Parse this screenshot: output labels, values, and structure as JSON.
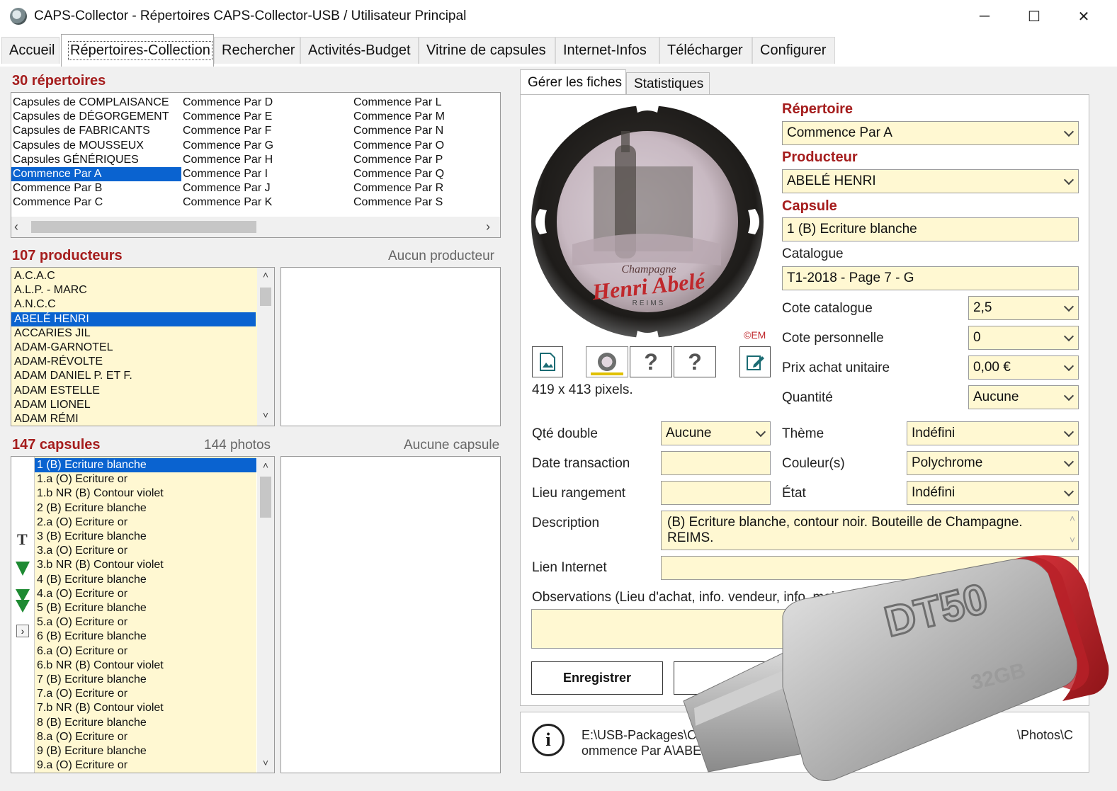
{
  "window": {
    "title": "CAPS-Collector - Répertoires CAPS-Collector-USB / Utilisateur Principal",
    "minimize": "─",
    "maximize": "☐",
    "close": "✕"
  },
  "tabs": [
    "Accueil",
    "Répertoires-Collection",
    "Rechercher",
    "Activités-Budget",
    "Vitrine de capsules",
    "Internet-Infos",
    "Télécharger",
    "Configurer"
  ],
  "repertoires": {
    "title": "30 répertoires",
    "col1": [
      "Capsules de COMPLAISANCE",
      "Capsules de DÉGORGEMENT",
      "Capsules de FABRICANTS",
      "Capsules de MOUSSEUX",
      "Capsules GÉNÉRIQUES",
      "Commence Par A",
      "Commence Par B",
      "Commence Par C"
    ],
    "col2": [
      "Commence Par D",
      "Commence Par E",
      "Commence Par F",
      "Commence Par G",
      "Commence Par H",
      "Commence Par I",
      "Commence Par J",
      "Commence Par K"
    ],
    "col3": [
      "Commence Par L",
      "Commence Par M",
      "Commence Par N",
      "Commence Par O",
      "Commence Par P",
      "Commence Par Q",
      "Commence Par R",
      "Commence Par S"
    ],
    "selected": "Commence Par A"
  },
  "producteurs": {
    "title": "107 producteurs",
    "right_label": "Aucun producteur",
    "items": [
      "A.C.A.C",
      "A.L.P. - MARC",
      "A.N.C.C",
      "ABELÉ HENRI",
      "ACCARIES JIL",
      "ADAM-GARNOTEL",
      "ADAM-RÉVOLTE",
      "ADAM DANIEL P. ET F.",
      "ADAM ESTELLE",
      "ADAM LIONEL",
      "ADAM RÉMI"
    ],
    "selected": "ABELÉ HENRI"
  },
  "capsules": {
    "title": "147 capsules",
    "photos": "144 photos",
    "right_label": "Aucune capsule",
    "items": [
      "1 (B) Ecriture blanche",
      "1.a (O) Ecriture or",
      "1.b NR (B) Contour violet",
      "2 (B) Ecriture blanche",
      "2.a (O) Ecriture or",
      "3 (B) Ecriture blanche",
      "3.a (O) Ecriture or",
      "3.b NR (B) Contour violet",
      "4 (B) Ecriture blanche",
      "4.a (O) Ecriture or",
      "5 (B) Ecriture blanche",
      "5.a (O) Ecriture or",
      "6 (B) Ecriture blanche",
      "6.a (O) Ecriture or",
      "6.b NR (B) Contour violet",
      "7 (B) Ecriture blanche",
      "7.a (O) Ecriture or",
      "7.b NR (B) Contour violet",
      "8 (B) Ecriture blanche",
      "8.a (O) Ecriture or",
      "9 (B) Ecriture blanche",
      "9.a (O) Ecriture or"
    ],
    "selected": "1 (B) Ecriture blanche",
    "side_tools": {
      "t": "T",
      "next": "▼",
      "last": "▼",
      "expand": "›"
    }
  },
  "right_tabs": [
    "Gérer les fiches",
    "Statistiques"
  ],
  "capsule_image": {
    "text_champagne": "Champagne",
    "text_brand": "Henri Abelé",
    "text_city": "REIMS",
    "copyright": "©EM",
    "size_text": "419 x 413 pixels.",
    "buttons": [
      "image-icon",
      "capsule-thumb-icon",
      "question-icon",
      "question-icon",
      "edit-icon"
    ],
    "question_mark": "?"
  },
  "form": {
    "repertoire_label": "Répertoire",
    "repertoire_value": "Commence Par A",
    "producteur_label": "Producteur",
    "producteur_value": "ABELÉ HENRI",
    "capsule_label": "Capsule",
    "capsule_value": "1 (B) Ecriture blanche",
    "catalogue_label": "Catalogue",
    "catalogue_value": "T1-2018 - Page 7 - G",
    "cote_catalogue_label": "Cote catalogue",
    "cote_catalogue_value": "2,5",
    "cote_perso_label": "Cote personnelle",
    "cote_perso_value": "0",
    "prix_label": "Prix achat unitaire",
    "prix_value": "0,00 €",
    "quantite_label": "Quantité",
    "quantite_value": "Aucune",
    "qte_double_label": "Qté double",
    "qte_double_value": "Aucune",
    "theme_label": "Thème",
    "theme_value": "Indéfini",
    "date_label": "Date transaction",
    "date_value": "",
    "couleurs_label": "Couleur(s)",
    "couleurs_value": "Polychrome",
    "lieu_label": "Lieu rangement",
    "lieu_value": "",
    "etat_label": "État",
    "etat_value": "Indéfini",
    "description_label": "Description",
    "description_value": "(B) Ecriture blanche, contour noir. Bouteille de Champagne. REIMS.",
    "lien_label": "Lien Internet",
    "lien_value": "",
    "observations_label": "Observations (Lieu d'achat, info. vendeur, info. mais",
    "observations_value": "",
    "save_button": "Enregistrer"
  },
  "info_bar": {
    "icon": "info-icon",
    "path_line1": "E:\\USB-Packages\\C",
    "path_line1_end": "\\Photos\\C",
    "path_line2": "ommence Par A\\ABE"
  },
  "usb_overlay": {
    "model": "DT50",
    "capacity": "32GB"
  }
}
